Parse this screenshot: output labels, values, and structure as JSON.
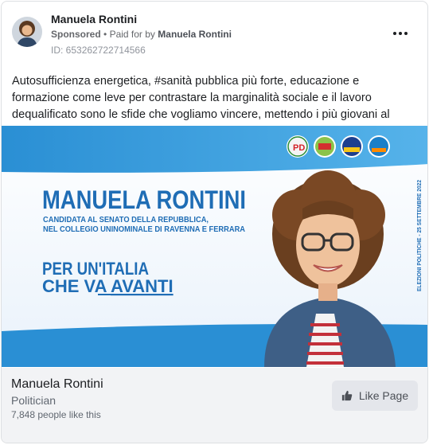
{
  "post": {
    "author": "Manuela Rontini",
    "sponsored_label": "Sponsored",
    "paid_for_prefix": "Paid for by",
    "payer": "Manuela Rontini",
    "ad_id": "ID: 653262722714566",
    "text": "Autosufficienza energetica, #sanità pubblica più forte, educazione e formazione come leve per contrastare la marginalità sociale e il lavoro dequalificato sono le sfide che vogliamo vincere, mettendo i più giovani al centro delle nostre priorità."
  },
  "creative": {
    "headline": "MANUELA RONTINI",
    "subtitle_line1": "CANDIDATA AL SENATO DELLA REPUBBLICA,",
    "subtitle_line2": "NEL COLLEGIO UNINOMINALE DI RAVENNA E FERRARA",
    "slogan_line1": "PER UN'ITALIA",
    "slogan_line2_a": "CHE VA ",
    "slogan_line2_b": "AVANTI",
    "side_text": "ELEZIONI POLITICHE - 25 SETTEMBRE 2022",
    "logos": [
      "PD",
      "Verdi Sinistra",
      "+Europa",
      "Impegno Civico"
    ],
    "colors": {
      "blue_band": "#2a8fd4",
      "text_blue": "#1f6db5",
      "light_band": "#eaf3fb"
    }
  },
  "page": {
    "name": "Manuela Rontini",
    "category": "Politician",
    "likes": "7,848 people like this",
    "like_button": "Like Page"
  }
}
